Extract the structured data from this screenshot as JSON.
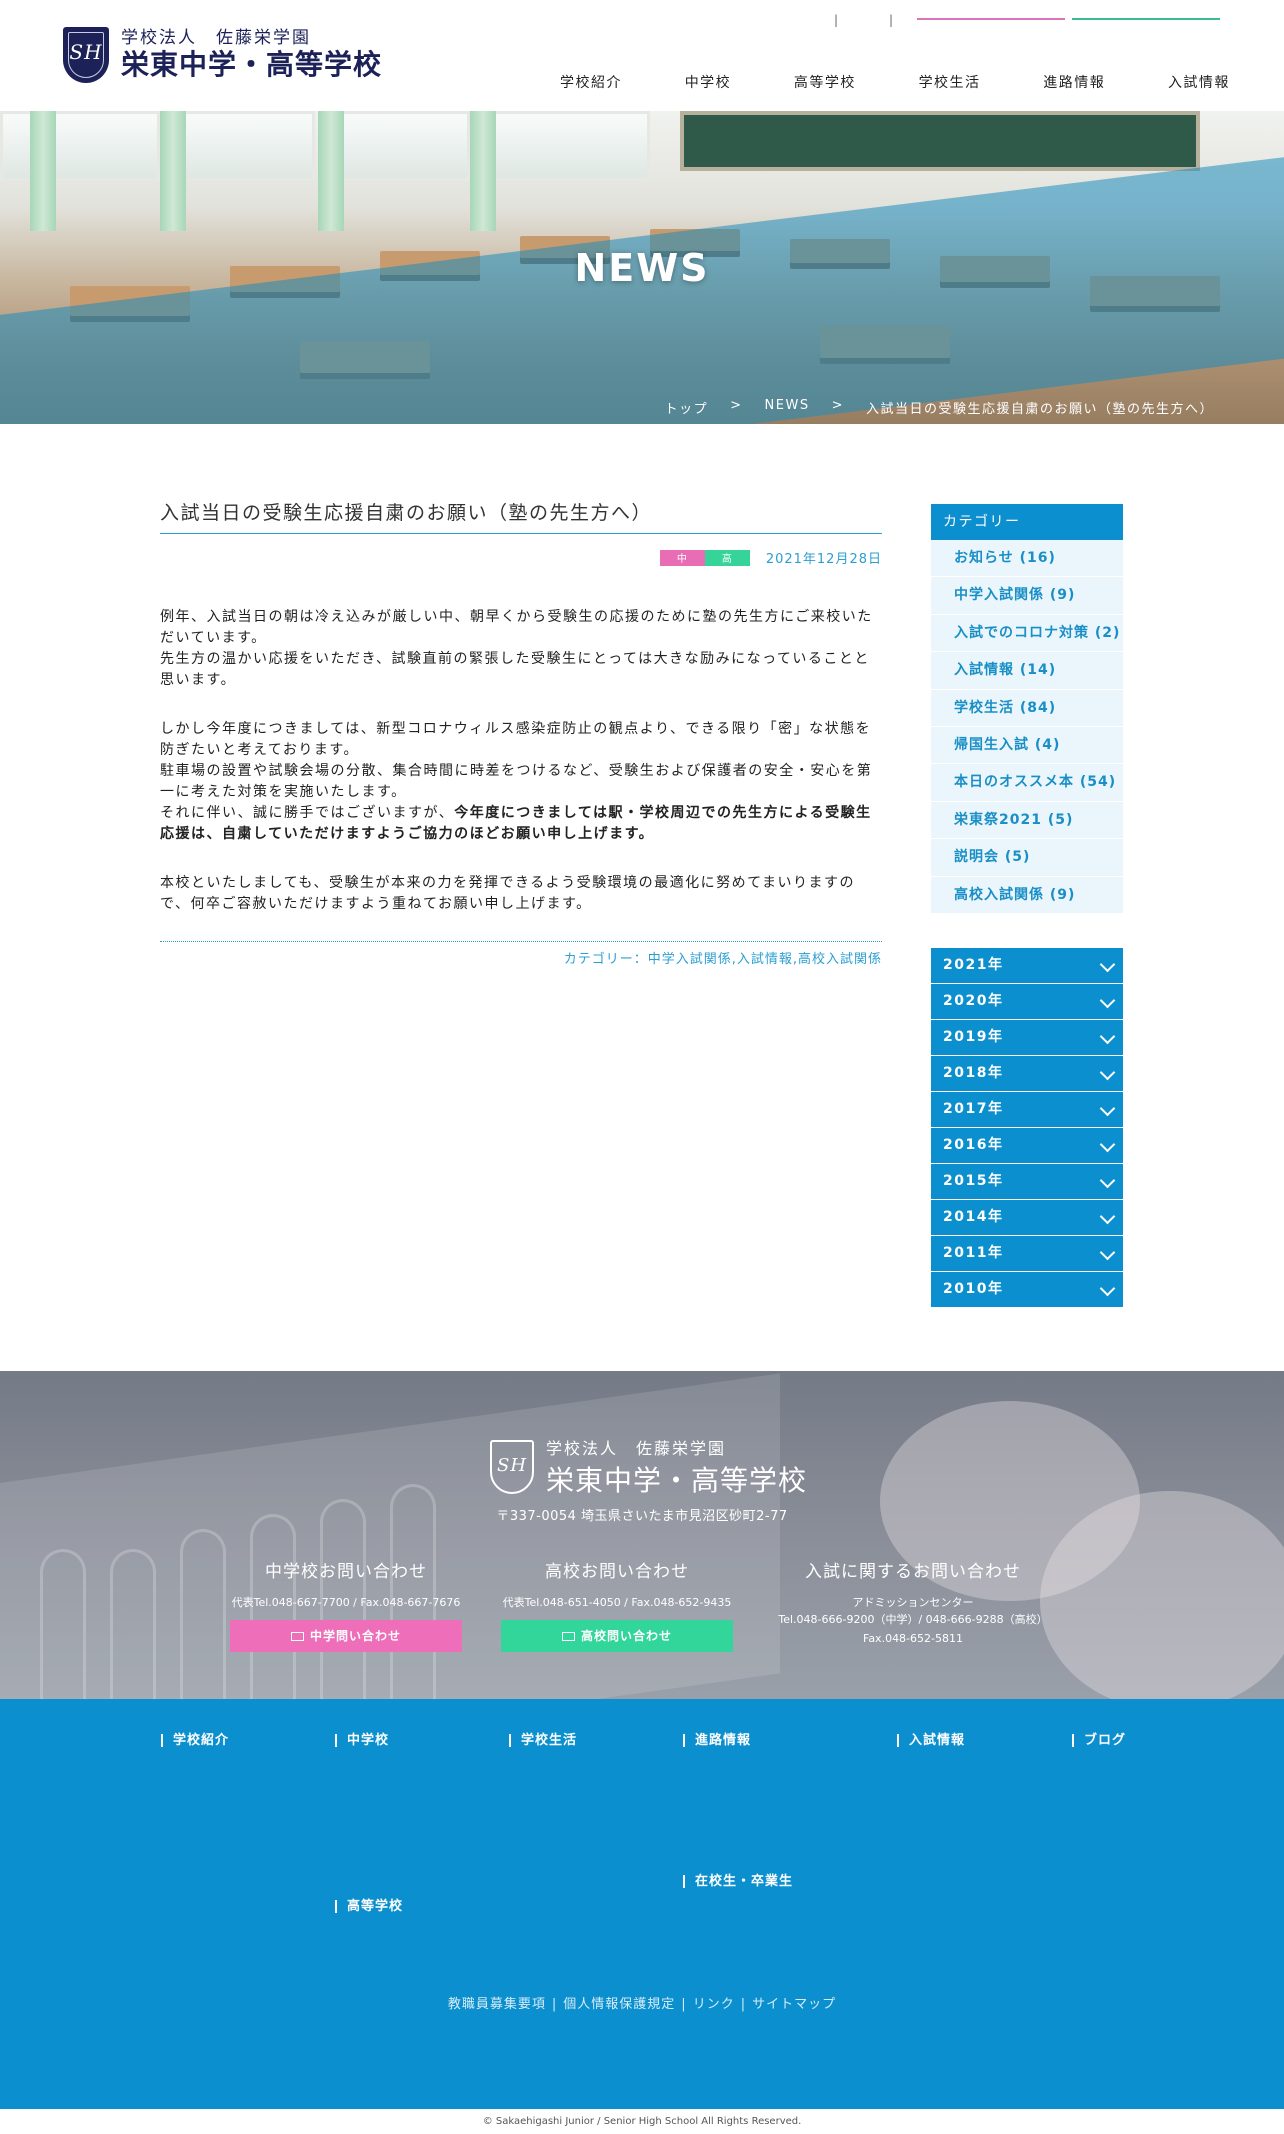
{
  "header": {
    "logo_sub": "学校法人　佐藤栄学園",
    "logo_main": "栄東中学・高等学校",
    "logo_mark": "SH",
    "util_sep1": "|",
    "util_sep2": "|",
    "nav": [
      "学校紹介",
      "中学校",
      "高等学校",
      "学校生活",
      "進路情報",
      "入試情報"
    ]
  },
  "hero": {
    "title": "NEWS",
    "breadcrumb": [
      "トップ",
      ">",
      "NEWS",
      ">",
      "入試当日の受験生応援自粛のお願い（塾の先生方へ）"
    ]
  },
  "article": {
    "title": "入試当日の受験生応援自粛のお願い（塾の先生方へ）",
    "tag_junior": "中",
    "tag_senior": "高",
    "date": "2021年12月28日",
    "p1": "例年、入試当日の朝は冷え込みが厳しい中、朝早くから受験生の応援のために塾の先生方にご来校いただいています。",
    "p1b": "先生方の温かい応援をいただき、試験直前の緊張した受験生にとっては大きな励みになっていることと思います。",
    "p2a": "しかし今年度につきましては、新型コロナウィルス感染症防止の観点より、できる限り「密」な状態を防ぎたいと考えております。",
    "p2b": "駐車場の設置や試験会場の分散、集合時間に時差をつけるなど、受験生および保護者の安全・安心を第一に考えた対策を実施いたします。",
    "p2c": "それに伴い、誠に勝手ではございますが、",
    "p2c_bold": "今年度につきましては駅・学校周辺での先生方による受験生応援は、自粛していただけますようご協力のほどお願い申し上げます。",
    "p3": "本校といたしましても、受験生が本来の力を発揮できるよう受験環境の最適化に努めてまいりますので、何卒ご容赦いただけますよう重ねてお願い申し上げます。",
    "categories": "カテゴリー：中学入試関係,入試情報,高校入試関係"
  },
  "sidebar": {
    "category_heading": "カテゴリー",
    "categories": [
      "お知らせ (16)",
      "中学入試関係 (9)",
      "入試でのコロナ対策 (2)",
      "入試情報 (14)",
      "学校生活 (84)",
      "帰国生入試 (4)",
      "本日のオススメ本 (54)",
      "栄東祭2021 (5)",
      "説明会 (5)",
      "高校入試関係 (9)"
    ],
    "years": [
      "2021年",
      "2020年",
      "2019年",
      "2018年",
      "2017年",
      "2016年",
      "2015年",
      "2014年",
      "2011年",
      "2010年"
    ]
  },
  "footer": {
    "logo_sub": "学校法人　佐藤栄学園",
    "logo_main": "栄東中学・高等学校",
    "logo_mark": "SH",
    "address": "〒337-0054 埼玉県さいたま市見沼区砂町2-77",
    "junior": {
      "heading": "中学校お問い合わせ",
      "tel": "代表Tel.048-667-7700 / Fax.048-667-7676",
      "button": "中学問い合わせ"
    },
    "senior": {
      "heading": "高校お問い合わせ",
      "tel": "代表Tel.048-651-4050 / Fax.048-652-9435",
      "button": "高校問い合わせ"
    },
    "admission": {
      "heading": "入試に関するお問い合わせ",
      "line1": "アドミッションセンター",
      "line2": "Tel.048-666-9200（中学）/ 048-666-9288（高校）",
      "line3": "Fax.048-652-5811"
    },
    "sitemap": {
      "school_intro": "学校紹介",
      "junior": "中学校",
      "school_life": "学校生活",
      "career": "進路情報",
      "admission": "入試情報",
      "blog": "ブログ",
      "students_alumni": "在校生・卒業生",
      "senior": "高等学校"
    },
    "links": [
      "教職員募集要項",
      "個人情報保護規定",
      "リンク",
      "サイトマップ"
    ],
    "link_sep": "|",
    "copyright": "© Sakaehigashi Junior / Senior High School All Rights Reserved."
  }
}
